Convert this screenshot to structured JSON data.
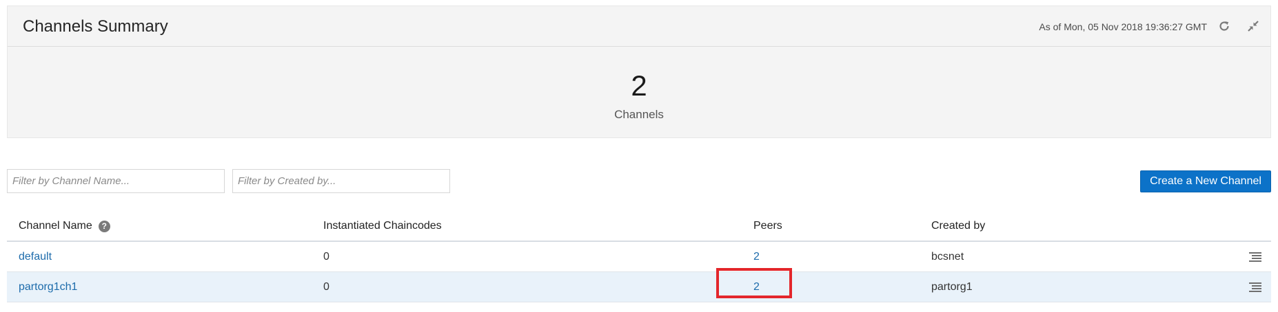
{
  "summary": {
    "title": "Channels Summary",
    "as_of": "As of Mon, 05 Nov 2018 19:36:27 GMT",
    "count": "2",
    "count_label": "Channels",
    "icons": [
      "refresh-icon",
      "collapse-icon"
    ]
  },
  "filters": {
    "channel_name_placeholder": "Filter by Channel Name...",
    "created_by_placeholder": "Filter by Created by..."
  },
  "actions": {
    "create_label": "Create a New Channel"
  },
  "table": {
    "headers": {
      "name": "Channel Name",
      "chaincodes": "Instantiated Chaincodes",
      "peers": "Peers",
      "created_by": "Created by"
    },
    "rows": [
      {
        "name": "default",
        "chaincodes": "0",
        "peers": "2",
        "created_by": "bcsnet",
        "selected": false
      },
      {
        "name": "partorg1ch1",
        "chaincodes": "0",
        "peers": "2",
        "created_by": "partorg1",
        "selected": true
      }
    ]
  },
  "colors": {
    "primary_button": "#0c72c8",
    "link": "#1c6bab",
    "highlight_box": "#e3262b",
    "selected_row": "#e9f2fa",
    "panel_background": "#f4f4f4"
  }
}
